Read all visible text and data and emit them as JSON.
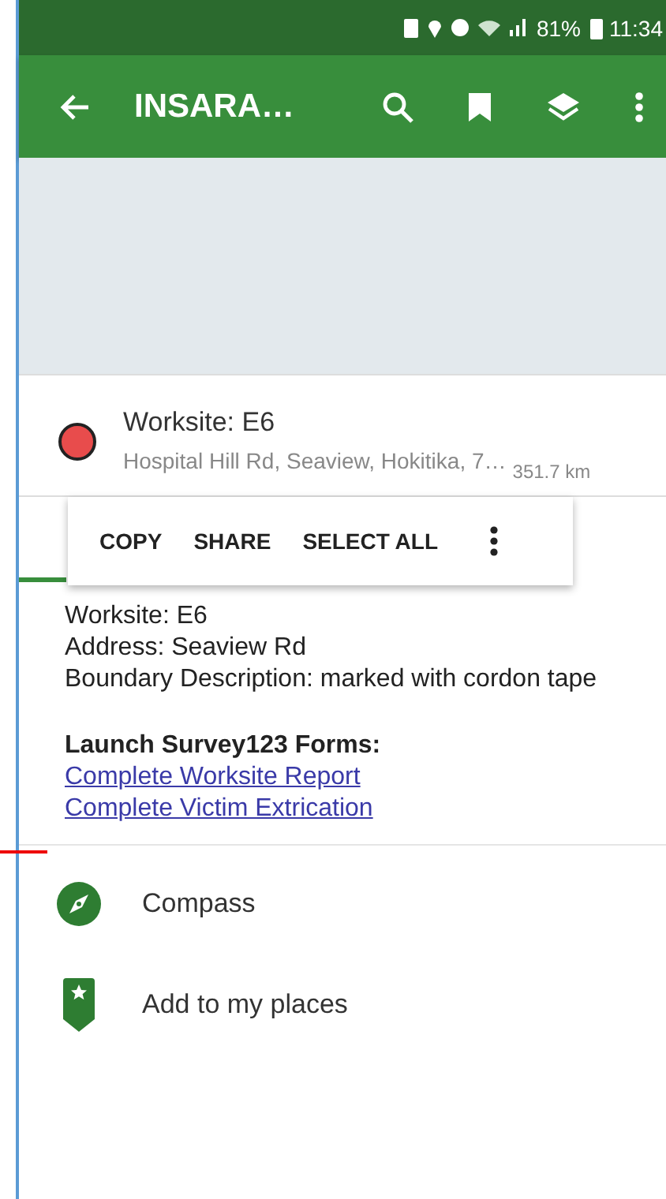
{
  "status_bar": {
    "battery": "81%",
    "time": "11:34"
  },
  "toolbar": {
    "title": "INSARA…"
  },
  "place": {
    "title": "Worksite: E6",
    "address": "Hospital Hill Rd, Seaview, Hokitika, 7…",
    "distance": "351.7 km",
    "color": "#e84c4c"
  },
  "text_menu": [
    "COPY",
    "SHARE",
    "SELECT ALL"
  ],
  "details": {
    "lines": [
      "Worksite: E6",
      "Address: Seaview Rd",
      "Boundary Description: marked with cordon tape"
    ],
    "forms_heading": "Launch Survey123 Forms:",
    "links": [
      "Complete Worksite Report",
      "Complete Victim Extrication"
    ]
  },
  "actions": [
    {
      "kind": "compass",
      "label": "Compass"
    },
    {
      "kind": "place",
      "label": "Add to my places"
    }
  ]
}
